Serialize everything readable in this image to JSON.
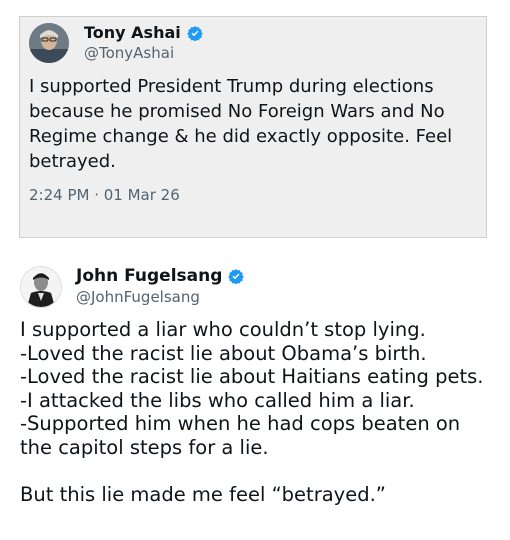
{
  "quoted_tweet": {
    "author_name": "Tony Ashai",
    "handle": "@TonyAshai",
    "text": "I supported President Trump during elections because he promised No Foreign Wars and No Regime change & he did exactly opposite. Feel betrayed.",
    "timestamp": "2:24 PM · 01 Mar 26",
    "verified_icon": "verified-badge-icon"
  },
  "main_tweet": {
    "author_name": "John Fugelsang",
    "handle": "@JohnFugelsang",
    "verified_icon": "verified-badge-icon",
    "lines": [
      "I supported a liar who couldn’t stop lying.",
      "-Loved the racist lie about Obama’s birth.",
      "-Loved the racist lie about Haitians eating pets.",
      "-I attacked the libs who called him a liar.",
      "-Supported him when he had cops beaten on",
      "the capitol steps for a lie."
    ],
    "closing_line": "But this lie made me feel “betrayed.”"
  },
  "colors": {
    "verified": "#1d9bf0",
    "card_bg": "#efefef",
    "secondary_text": "#536471"
  }
}
